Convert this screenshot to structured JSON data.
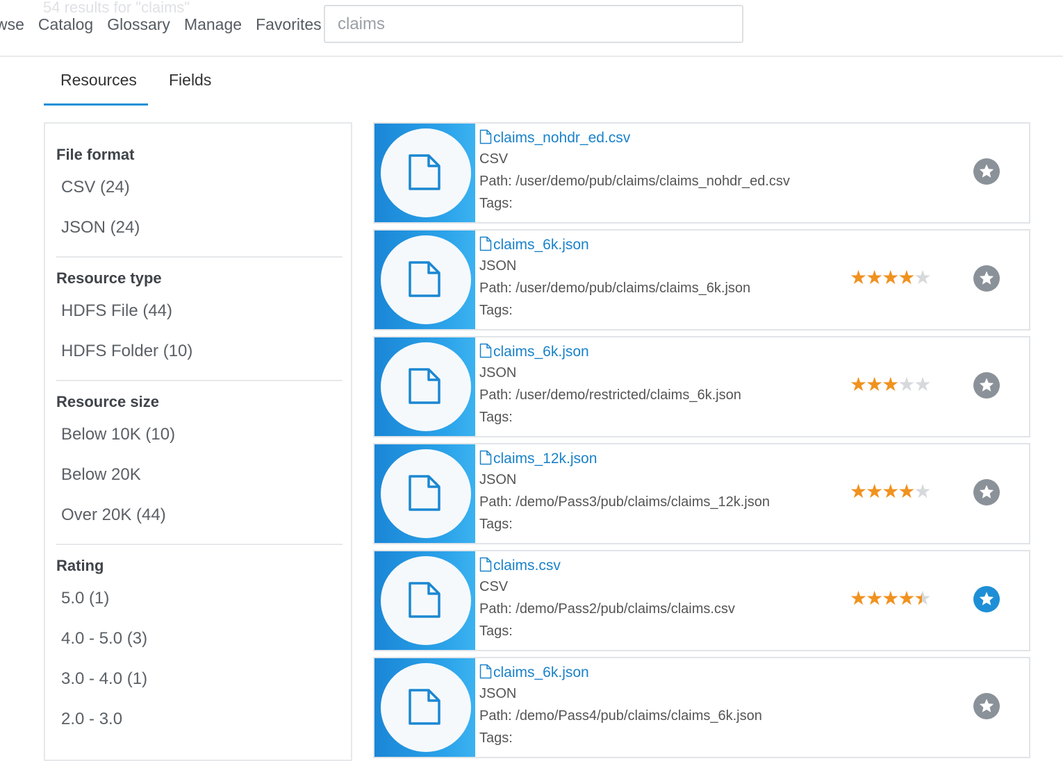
{
  "header": {
    "results_count": "54 results for \"claims\"",
    "nav": [
      "wse",
      "Catalog",
      "Glossary",
      "Manage",
      "Favorites"
    ],
    "search_value": "claims"
  },
  "tabs": [
    {
      "label": "Resources",
      "active": true
    },
    {
      "label": "Fields",
      "active": false
    }
  ],
  "filters": {
    "file_format": {
      "title": "File format",
      "items": [
        "CSV (24)",
        "JSON (24)"
      ]
    },
    "resource_type": {
      "title": "Resource type",
      "items": [
        "HDFS File (44)",
        "HDFS Folder (10)"
      ]
    },
    "resource_size": {
      "title": "Resource size",
      "items": [
        "Below 10K (10)",
        "Below 20K",
        "Over 20K (44)"
      ]
    },
    "rating": {
      "title": "Rating",
      "items": [
        "5.0 (1)",
        "4.0 - 5.0 (3)",
        "3.0 - 4.0 (1)",
        "2.0 - 3.0"
      ]
    }
  },
  "results": [
    {
      "name": "claims_nohdr_ed.csv",
      "format": "CSV",
      "path": "Path: /user/demo/pub/claims/claims_nohdr_ed.csv",
      "tags": "Tags:",
      "rating": null,
      "favorite": false
    },
    {
      "name": "claims_6k.json",
      "format": "JSON",
      "path": "Path: /user/demo/pub/claims/claims_6k.json",
      "tags": "Tags:",
      "rating": 4,
      "favorite": false
    },
    {
      "name": "claims_6k.json",
      "format": "JSON",
      "path": "Path: /user/demo/restricted/claims_6k.json",
      "tags": "Tags:",
      "rating": 3,
      "favorite": false
    },
    {
      "name": "claims_12k.json",
      "format": "JSON",
      "path": "Path: /demo/Pass3/pub/claims/claims_12k.json",
      "tags": "Tags:",
      "rating": 4,
      "favorite": false
    },
    {
      "name": "claims.csv",
      "format": "CSV",
      "path": "Path: /demo/Pass2/pub/claims/claims.csv",
      "tags": "Tags:",
      "rating": 4.5,
      "favorite": true
    },
    {
      "name": "claims_6k.json",
      "format": "JSON",
      "path": "Path: /demo/Pass4/pub/claims/claims_6k.json",
      "tags": "Tags:",
      "rating": null,
      "favorite": false
    }
  ],
  "colors": {
    "accent": "#1e8fd6",
    "link": "#1a82c9",
    "star": "#f0921f",
    "fav_off": "#8a9199",
    "fav_on": "#1e8fd6"
  },
  "icons": {
    "thumb": "file-icon",
    "name": "file-outline-icon",
    "favorite": "star-circle-icon"
  }
}
